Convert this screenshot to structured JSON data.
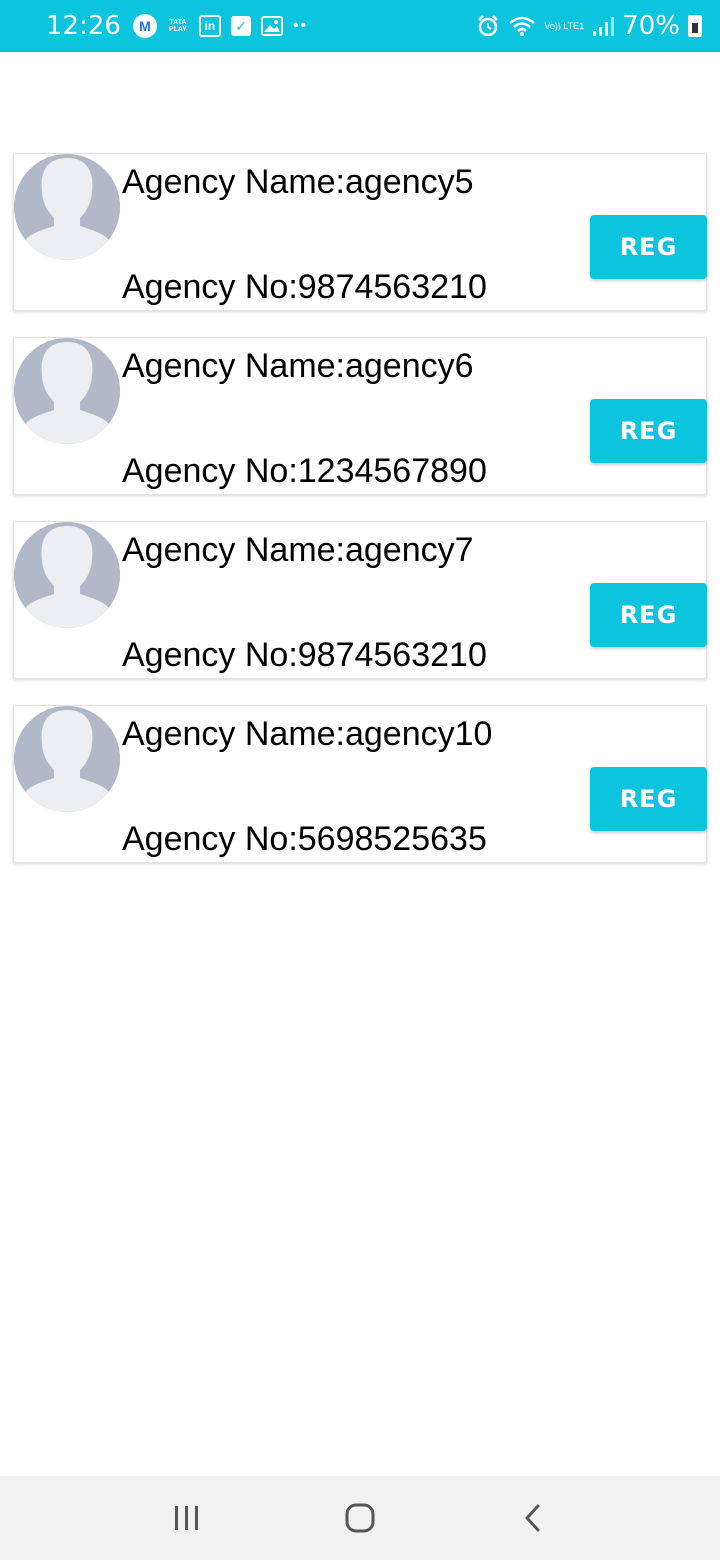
{
  "status_bar": {
    "time": "12:26",
    "battery": "70%",
    "tata_play": "TATA PLAY",
    "volte": "Vo)) LTE1",
    "icons": [
      "m-app-icon",
      "tata-play-icon",
      "linkedin-icon",
      "check-icon",
      "gallery-icon",
      "more-dots-icon",
      "alarm-icon",
      "wifi-icon",
      "signal-icon",
      "battery-icon"
    ]
  },
  "colors": {
    "accent": "#0cc4de",
    "avatar_bg": "#b1b9c9",
    "avatar_fg": "#eceef1"
  },
  "agencies": [
    {
      "name": "Agency Name:agency5",
      "number": "Agency No:9874563210",
      "button": "REG"
    },
    {
      "name": "Agency Name:agency6",
      "number": "Agency No:1234567890",
      "button": "REG"
    },
    {
      "name": "Agency Name:agency7",
      "number": "Agency No:9874563210",
      "button": "REG"
    },
    {
      "name": "Agency Name:agency10",
      "number": "Agency No:5698525635",
      "button": "REG"
    }
  ],
  "nav": {
    "buttons": [
      "recent-apps-icon",
      "home-icon",
      "back-icon"
    ]
  }
}
